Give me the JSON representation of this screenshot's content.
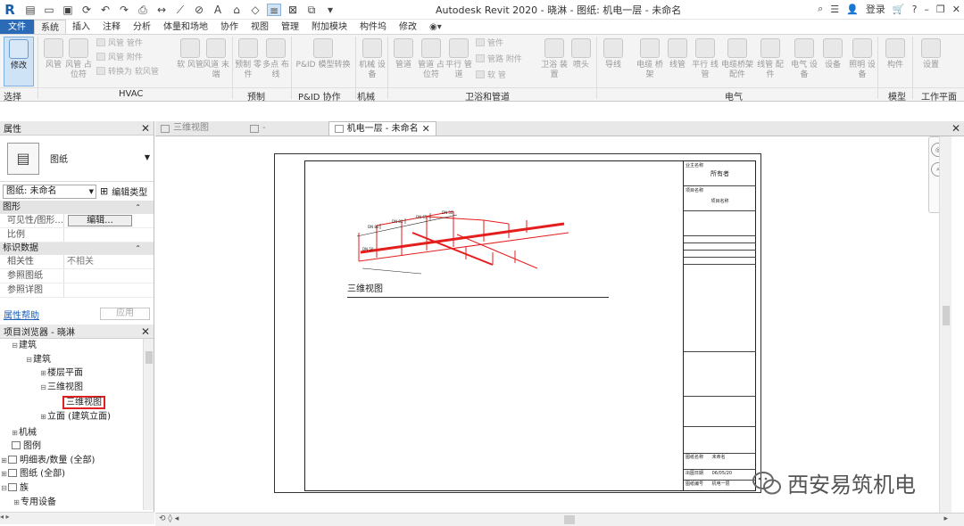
{
  "window": {
    "title": "Autodesk Revit 2020 - 晓淋 - 图纸: 机电一层 - 未命名",
    "user_label": "登录",
    "help_label": "?"
  },
  "ribbon_tabs": [
    "文件",
    "系统",
    "插入",
    "注释",
    "分析",
    "体量和场地",
    "协作",
    "视图",
    "管理",
    "附加模块",
    "构件坞",
    "修改"
  ],
  "ribbon": {
    "modify_label": "修改",
    "buttons": [
      {
        "label": "风管"
      },
      {
        "label": "风管 占位符"
      },
      {
        "label": "软 风管"
      },
      {
        "label": "风道 末端"
      },
      {
        "label": "预制 零件"
      },
      {
        "label": "多点 布线"
      },
      {
        "label": "P&ID 模型转换"
      },
      {
        "label": "机械 设备"
      },
      {
        "label": "管道"
      },
      {
        "label": "管道 占位符"
      },
      {
        "label": "平行 管道"
      },
      {
        "label": "卫浴 装置"
      },
      {
        "label": "喷头"
      },
      {
        "label": "导线"
      },
      {
        "label": "电缆 桥架"
      },
      {
        "label": "线管"
      },
      {
        "label": "平行 线管"
      },
      {
        "label": "电缆桥架 配件"
      },
      {
        "label": "线管 配件"
      },
      {
        "label": "电气 设备"
      },
      {
        "label": "设备"
      },
      {
        "label": "照明 设备"
      },
      {
        "label": "构件"
      },
      {
        "label": "设置"
      }
    ],
    "small_items": [
      "风管 管件",
      "风管 附件",
      "转换为 软风管",
      "管件",
      "管路 附件",
      "软 管"
    ],
    "panels": [
      "选择",
      "HVAC",
      "预制",
      "P&ID 协作",
      "机械",
      "卫浴和管道",
      "电气",
      "模型",
      "工作平面"
    ]
  },
  "properties": {
    "header": "属性",
    "type_name": "图纸",
    "selector_value": "图纸: 未命名",
    "edit_type": "编辑类型",
    "groups": [
      {
        "name": "图形",
        "rows": [
          {
            "key": "可见性/图形...",
            "value": "编辑...",
            "is_button": true
          },
          {
            "key": "比例",
            "value": ""
          }
        ]
      },
      {
        "name": "标识数据",
        "rows": [
          {
            "key": "相关性",
            "value": "不相关"
          },
          {
            "key": "参照图纸",
            "value": ""
          },
          {
            "key": "参照详图",
            "value": ""
          }
        ]
      }
    ],
    "help_link": "属性帮助",
    "apply_button": "应用"
  },
  "project_browser": {
    "header": "项目浏览器 - 晓淋",
    "nodes": [
      {
        "label": "建筑",
        "depth": 1,
        "toggle": "⊟"
      },
      {
        "label": "建筑",
        "depth": 2,
        "toggle": "⊟"
      },
      {
        "label": "楼层平面",
        "depth": 3,
        "toggle": "⊞"
      },
      {
        "label": "三维视图",
        "depth": 3,
        "toggle": "⊟"
      },
      {
        "label": "三维视图",
        "depth": 4,
        "toggle": "",
        "highlight": true
      },
      {
        "label": "立面 (建筑立面)",
        "depth": 3,
        "toggle": "⊞"
      },
      {
        "label": "机械",
        "depth": 1,
        "toggle": "⊞"
      },
      {
        "label": "图例",
        "depth": 0,
        "toggle": ""
      },
      {
        "label": "明细表/数量 (全部)",
        "depth": 0,
        "toggle": "⊞"
      },
      {
        "label": "图纸 (全部)",
        "depth": 0,
        "toggle": "⊞"
      },
      {
        "label": "族",
        "depth": 0,
        "toggle": "⊟"
      },
      {
        "label": "专用设备",
        "depth": 1,
        "toggle": "⊞"
      }
    ]
  },
  "doc_tabs": [
    {
      "label": "三维视图",
      "active": false
    },
    {
      "label": "-",
      "active": false
    },
    {
      "label": "机电一层 - 未命名",
      "active": true
    }
  ],
  "sheet": {
    "view_title": "三维视图",
    "titleblock": {
      "owner_label": "业主名称",
      "owner": "所有者",
      "project_label": "项目名称",
      "project": "项目名称",
      "drawing_name_label": "图纸名称",
      "drawing_name": "未命名",
      "date_label": "出图日期",
      "date": "06/05/20",
      "sheet_no_label": "图纸编号",
      "sheet_no": "机电一层"
    }
  },
  "watermark": "西安易筑机电"
}
